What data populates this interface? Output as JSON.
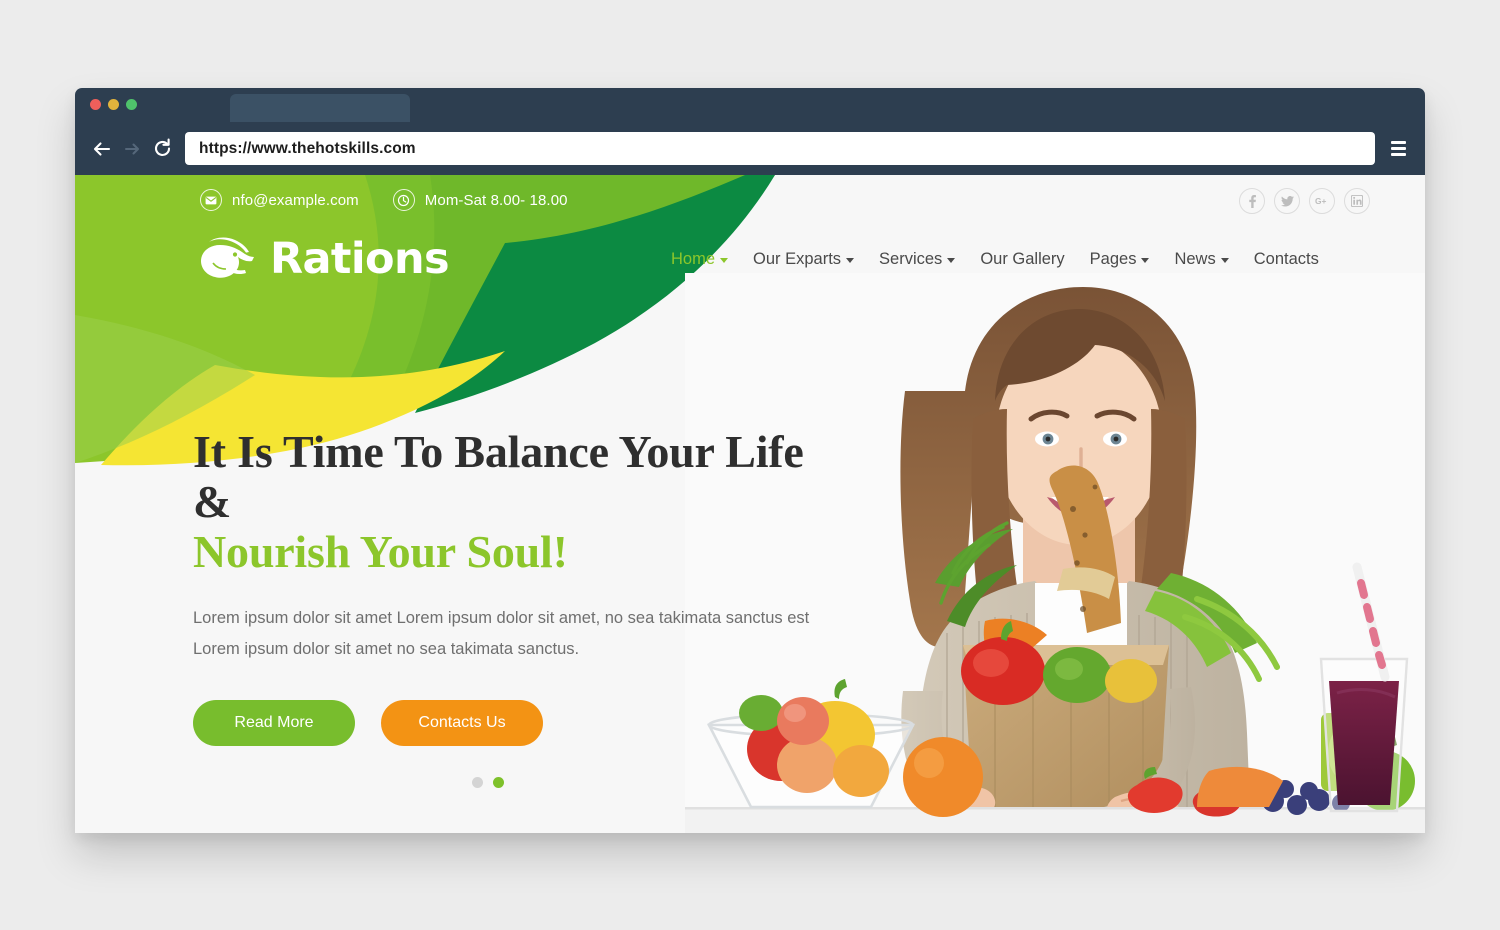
{
  "browser": {
    "url": "https://www.thehotskills.com",
    "back_icon": "back-arrow-icon",
    "forward_icon": "forward-arrow-icon",
    "reload_icon": "reload-icon",
    "menu_icon": "hamburger-menu-icon"
  },
  "topbar": {
    "email": "nfo@example.com",
    "hours": "Mom-Sat 8.00- 18.00",
    "socials": [
      {
        "name": "facebook",
        "glyph": "f"
      },
      {
        "name": "twitter",
        "glyph": "✈"
      },
      {
        "name": "google-plus",
        "glyph": "G+"
      },
      {
        "name": "linkedin",
        "glyph": "in"
      }
    ]
  },
  "header": {
    "logo_text": "Rations",
    "nav": [
      {
        "label": "Home",
        "caret": true,
        "active": true
      },
      {
        "label": "Our Exparts",
        "caret": true,
        "active": false
      },
      {
        "label": "Services",
        "caret": true,
        "active": false
      },
      {
        "label": "Our Gallery",
        "caret": false,
        "active": false
      },
      {
        "label": "Pages",
        "caret": true,
        "active": false
      },
      {
        "label": "News",
        "caret": true,
        "active": false
      },
      {
        "label": "Contacts",
        "caret": false,
        "active": false
      }
    ]
  },
  "hero": {
    "title_line1": "It Is Time To Balance Your Life &",
    "title_line2": "Nourish Your Soul!",
    "paragraph": "Lorem ipsum dolor sit amet Lorem ipsum dolor sit amet, no sea takimata sanctus est Lorem ipsum dolor sit amet no sea takimata sanctus.",
    "primary_button": "Read More",
    "secondary_button": "Contacts Us",
    "slides": [
      {
        "active": false
      },
      {
        "active": true
      }
    ]
  },
  "colors": {
    "brand_green": "#8cc62b",
    "light_green": "#8cc62b",
    "mid_green": "#6db62a",
    "dark_green": "#0c8a42",
    "yellow": "#f5e533",
    "orange": "#f39314",
    "chrome_dark": "#2d3e50",
    "text_dark": "#2f2f2f",
    "text_muted": "#6f6f6f"
  }
}
